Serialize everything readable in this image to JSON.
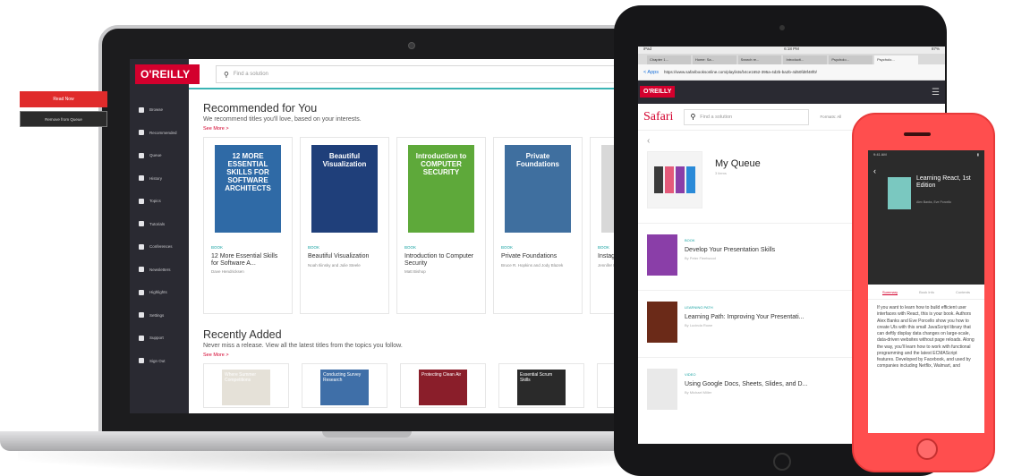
{
  "laptop": {
    "logo": "O'REILLY",
    "search_placeholder": "Find a solution",
    "nav": [
      "Browse",
      "Recommended",
      "Queue",
      "History",
      "Topics",
      "Tutorials",
      "Conferences",
      "Newsletters",
      "Highlights",
      "Settings",
      "Support",
      "Sign Out"
    ],
    "recommended": {
      "title": "Recommended for You",
      "subtitle": "We recommend titles you'll love, based on your interests.",
      "see_more": "See More >",
      "cards": [
        {
          "tag": "BOOK",
          "title": "12 More Essential Skills for Software A...",
          "author": "Dave Hendricksen",
          "cover_color": "#2f6aa6",
          "cover_text": "12 MORE ESSENTIAL SKILLS FOR SOFTWARE ARCHITECTS"
        },
        {
          "tag": "BOOK",
          "title": "Beautiful Visualization",
          "author": "Noah Iliinsky and Julie Steele",
          "cover_color": "#1f3f7a",
          "cover_text": "Beautiful Visualization"
        },
        {
          "tag": "BOOK",
          "title": "Introduction to Computer Security",
          "author": "Matt Bishop",
          "cover_color": "#5ea93a",
          "cover_text": "Introduction to COMPUTER SECURITY"
        },
        {
          "tag": "BOOK",
          "title": "Private Foundations",
          "author": "Bruce R. Hopkins and Jody Blazek",
          "cover_color": "#3f6f9f",
          "cover_text": "Private Foundations"
        },
        {
          "tag": "BOOK",
          "title": "Instag Busine",
          "author": "Jennifer Herm and Cor",
          "cover_color": "#d8d8d8",
          "cover_text": "Ins For"
        }
      ]
    },
    "recent": {
      "title": "Recently Added",
      "subtitle": "Never miss a release. View all the latest titles from the topics you follow.",
      "see_more": "See More >",
      "covers": [
        {
          "color": "#e5e1d8",
          "text": "Where Summer Competitions"
        },
        {
          "color": "#3f6fa8",
          "text": "Conducting Survey Research"
        },
        {
          "color": "#8a1e2a",
          "text": "Protecting Clean Air"
        },
        {
          "color": "#2a2a2a",
          "text": "Essential Scrum Skills"
        },
        {
          "color": "#6aa34a",
          "text": ""
        }
      ]
    }
  },
  "tablet": {
    "status_left": "iPad",
    "status_time": "6:18 PM",
    "status_right": "87%",
    "tabs": [
      "Chapter 1...",
      "Home: Sa...",
      "Search re...",
      "Introducti...",
      "Psycholo...",
      "Psycholo..."
    ],
    "back_label": "< Apps",
    "url": "https://www.safaribooksonline.com/playlists/b4ce1652-395a-4d2b-ba2b-4d50fd8f48f0/",
    "logo": "O'REILLY",
    "brand": "Safari",
    "search_placeholder": "Find a solution",
    "extra": "Formats: All",
    "queue_title": "My Queue",
    "queue_count": "3 items",
    "items": [
      {
        "tag": "BOOK",
        "title": "Develop Your Presentation Skills",
        "by": "By Peter Fleetwood",
        "color": "#8a3ea8"
      },
      {
        "tag": "LEARNING PATH",
        "title": "Learning Path: Improving Your Presentati...",
        "by": "By Lucinda Rowe",
        "color": "#6b2a18"
      },
      {
        "tag": "VIDEO",
        "title": "Using Google Docs, Sheets, Slides, and D...",
        "by": "By Michael Miller",
        "color": "#e9e9e9"
      }
    ]
  },
  "phone": {
    "status": "9:41 AM",
    "book_title": "Learning React, 1st Edition",
    "book_sub": "Alex Banks, Eve Porcello",
    "read_now": "Read Now",
    "remove": "Remove from Queue",
    "tabs": [
      "Summary",
      "Book Info",
      "Contents"
    ],
    "body": "If you want to learn how to build efficient user interfaces with React, this is your book. Authors Alex Banks and Eve Porcello show you how to create UIs with this small JavaScript library that can deftly display data changes on large-scale, data-driven websites without page reloads. Along the way, you'll learn how to work with functional programming and the latest ECMAScript features. Developed by Facebook, and used by companies including Netflix, Walmart, and"
  }
}
